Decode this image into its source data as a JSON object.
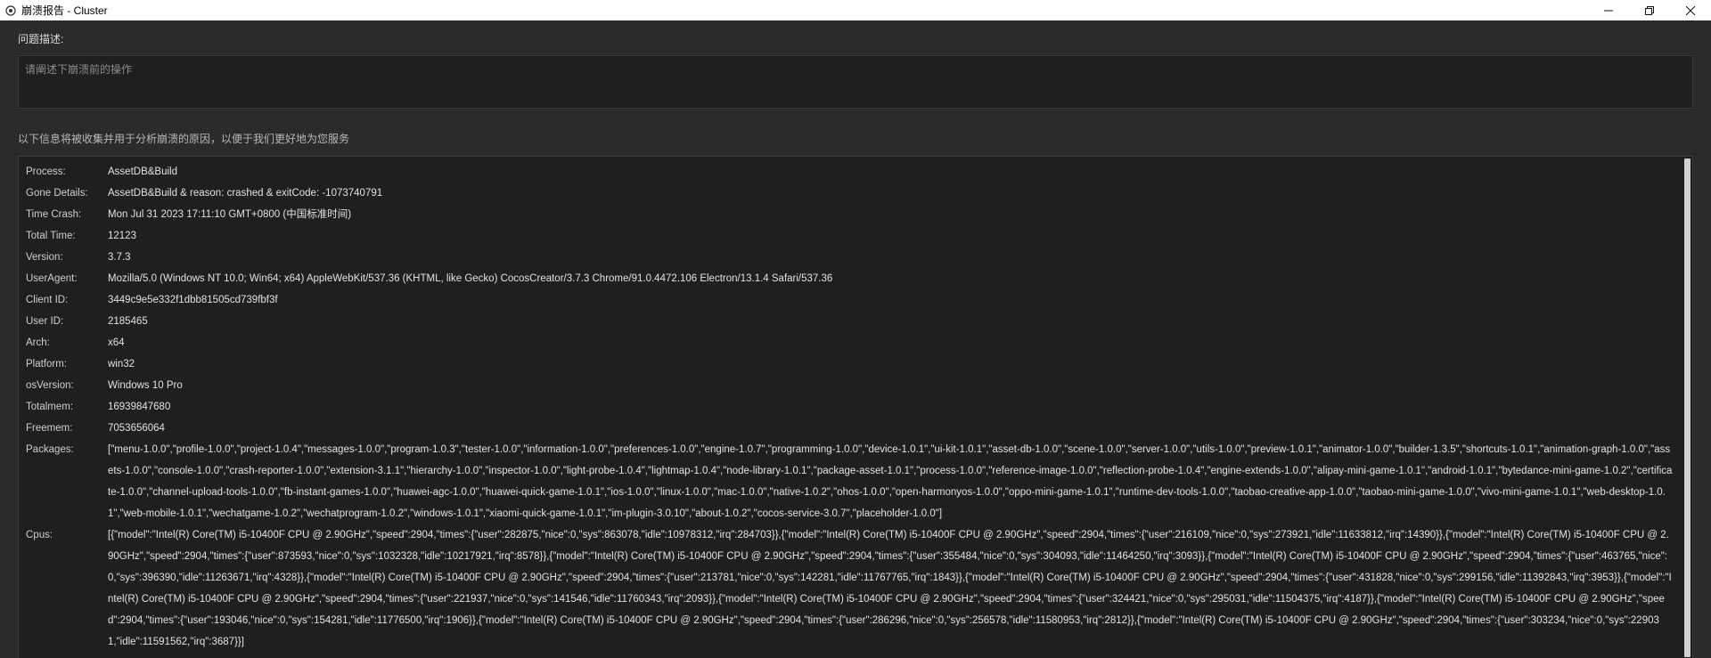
{
  "window": {
    "title": "崩溃报告 - Cluster",
    "minimize": "—",
    "maximize": "❐",
    "close": "✕"
  },
  "description": {
    "label": "问题描述:",
    "placeholder": "请阐述下崩溃前的操作",
    "value": ""
  },
  "notice": "以下信息将被收集并用于分析崩溃的原因，以便于我们更好地为您服务",
  "info": [
    {
      "key": "Process:",
      "value": "AssetDB&Build"
    },
    {
      "key": "Gone Details:",
      "value": "AssetDB&Build & reason: crashed & exitCode: -1073740791"
    },
    {
      "key": "Time Crash:",
      "value": "Mon Jul 31 2023 17:11:10 GMT+0800 (中国标准时间)"
    },
    {
      "key": "Total Time:",
      "value": "12123"
    },
    {
      "key": "Version:",
      "value": "3.7.3"
    },
    {
      "key": "UserAgent:",
      "value": "Mozilla/5.0 (Windows NT 10.0; Win64; x64) AppleWebKit/537.36 (KHTML, like Gecko) CocosCreator/3.7.3 Chrome/91.0.4472.106 Electron/13.1.4 Safari/537.36"
    },
    {
      "key": "Client ID:",
      "value": "3449c9e5e332f1dbb81505cd739fbf3f"
    },
    {
      "key": "User ID:",
      "value": "2185465"
    },
    {
      "key": "Arch:",
      "value": "x64"
    },
    {
      "key": "Platform:",
      "value": "win32"
    },
    {
      "key": "osVersion:",
      "value": "Windows 10 Pro"
    },
    {
      "key": "Totalmem:",
      "value": "16939847680"
    },
    {
      "key": "Freemem:",
      "value": "7053656064"
    },
    {
      "key": "Packages:",
      "value": "[\"menu-1.0.0\",\"profile-1.0.0\",\"project-1.0.4\",\"messages-1.0.0\",\"program-1.0.3\",\"tester-1.0.0\",\"information-1.0.0\",\"preferences-1.0.0\",\"engine-1.0.7\",\"programming-1.0.0\",\"device-1.0.1\",\"ui-kit-1.0.1\",\"asset-db-1.0.0\",\"scene-1.0.0\",\"server-1.0.0\",\"utils-1.0.0\",\"preview-1.0.1\",\"animator-1.0.0\",\"builder-1.3.5\",\"shortcuts-1.0.1\",\"animation-graph-1.0.0\",\"assets-1.0.0\",\"console-1.0.0\",\"crash-reporter-1.0.0\",\"extension-3.1.1\",\"hierarchy-1.0.0\",\"inspector-1.0.0\",\"light-probe-1.0.4\",\"lightmap-1.0.4\",\"node-library-1.0.1\",\"package-asset-1.0.1\",\"process-1.0.0\",\"reference-image-1.0.0\",\"reflection-probe-1.0.4\",\"engine-extends-1.0.0\",\"alipay-mini-game-1.0.1\",\"android-1.0.1\",\"bytedance-mini-game-1.0.2\",\"certificate-1.0.0\",\"channel-upload-tools-1.0.0\",\"fb-instant-games-1.0.0\",\"huawei-agc-1.0.0\",\"huawei-quick-game-1.0.1\",\"ios-1.0.0\",\"linux-1.0.0\",\"mac-1.0.0\",\"native-1.0.2\",\"ohos-1.0.0\",\"open-harmonyos-1.0.0\",\"oppo-mini-game-1.0.1\",\"runtime-dev-tools-1.0.0\",\"taobao-creative-app-1.0.0\",\"taobao-mini-game-1.0.0\",\"vivo-mini-game-1.0.1\",\"web-desktop-1.0.1\",\"web-mobile-1.0.1\",\"wechatgame-1.0.2\",\"wechatprogram-1.0.2\",\"windows-1.0.1\",\"xiaomi-quick-game-1.0.1\",\"im-plugin-3.0.10\",\"about-1.0.2\",\"cocos-service-3.0.7\",\"placeholder-1.0.0\"]"
    },
    {
      "key": "Cpus:",
      "value": "[{\"model\":\"Intel(R) Core(TM) i5-10400F CPU @ 2.90GHz\",\"speed\":2904,\"times\":{\"user\":282875,\"nice\":0,\"sys\":863078,\"idle\":10978312,\"irq\":284703}},{\"model\":\"Intel(R) Core(TM) i5-10400F CPU @ 2.90GHz\",\"speed\":2904,\"times\":{\"user\":216109,\"nice\":0,\"sys\":273921,\"idle\":11633812,\"irq\":14390}},{\"model\":\"Intel(R) Core(TM) i5-10400F CPU @ 2.90GHz\",\"speed\":2904,\"times\":{\"user\":873593,\"nice\":0,\"sys\":1032328,\"idle\":10217921,\"irq\":8578}},{\"model\":\"Intel(R) Core(TM) i5-10400F CPU @ 2.90GHz\",\"speed\":2904,\"times\":{\"user\":355484,\"nice\":0,\"sys\":304093,\"idle\":11464250,\"irq\":3093}},{\"model\":\"Intel(R) Core(TM) i5-10400F CPU @ 2.90GHz\",\"speed\":2904,\"times\":{\"user\":463765,\"nice\":0,\"sys\":396390,\"idle\":11263671,\"irq\":4328}},{\"model\":\"Intel(R) Core(TM) i5-10400F CPU @ 2.90GHz\",\"speed\":2904,\"times\":{\"user\":213781,\"nice\":0,\"sys\":142281,\"idle\":11767765,\"irq\":1843}},{\"model\":\"Intel(R) Core(TM) i5-10400F CPU @ 2.90GHz\",\"speed\":2904,\"times\":{\"user\":431828,\"nice\":0,\"sys\":299156,\"idle\":11392843,\"irq\":3953}},{\"model\":\"Intel(R) Core(TM) i5-10400F CPU @ 2.90GHz\",\"speed\":2904,\"times\":{\"user\":221937,\"nice\":0,\"sys\":141546,\"idle\":11760343,\"irq\":2093}},{\"model\":\"Intel(R) Core(TM) i5-10400F CPU @ 2.90GHz\",\"speed\":2904,\"times\":{\"user\":324421,\"nice\":0,\"sys\":295031,\"idle\":11504375,\"irq\":4187}},{\"model\":\"Intel(R) Core(TM) i5-10400F CPU @ 2.90GHz\",\"speed\":2904,\"times\":{\"user\":193046,\"nice\":0,\"sys\":154281,\"idle\":11776500,\"irq\":1906}},{\"model\":\"Intel(R) Core(TM) i5-10400F CPU @ 2.90GHz\",\"speed\":2904,\"times\":{\"user\":286296,\"nice\":0,\"sys\":256578,\"idle\":11580953,\"irq\":2812}},{\"model\":\"Intel(R) Core(TM) i5-10400F CPU @ 2.90GHz\",\"speed\":2904,\"times\":{\"user\":303234,\"nice\":0,\"sys\":229031,\"idle\":11591562,\"irq\":3687}}]"
    }
  ]
}
